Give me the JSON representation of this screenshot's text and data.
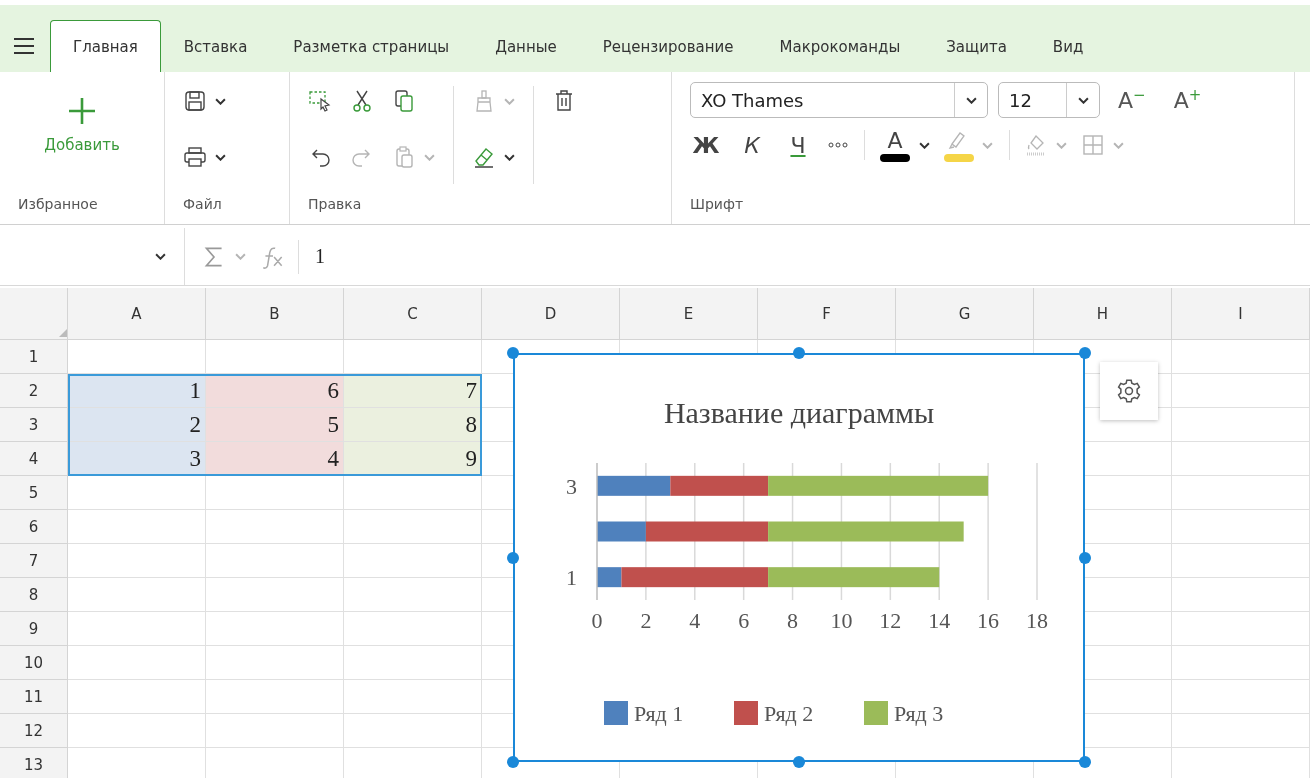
{
  "tabs": [
    {
      "label": "Главная",
      "selected": true
    },
    {
      "label": "Вставка",
      "selected": false
    },
    {
      "label": "Разметка страницы",
      "selected": false
    },
    {
      "label": "Данные",
      "selected": false
    },
    {
      "label": "Рецензирование",
      "selected": false
    },
    {
      "label": "Макрокоманды",
      "selected": false
    },
    {
      "label": "Защита",
      "selected": false
    },
    {
      "label": "Вид",
      "selected": false
    }
  ],
  "ribbon": {
    "favorites": {
      "label": "Избранное",
      "add_button": "Добавить"
    },
    "file": {
      "label": "Файл",
      "columns": [
        [
          {
            "kind": "save",
            "caret": true,
            "disabled": false
          },
          {
            "kind": "print",
            "caret": true,
            "disabled": false
          }
        ]
      ]
    },
    "edit": {
      "label": "Правка",
      "columns": [
        {
          "divider_before": false,
          "tools": [
            {
              "kind": "select",
              "caret": false,
              "disabled": false
            },
            {
              "kind": "undo",
              "caret": false,
              "disabled": false
            }
          ]
        },
        {
          "divider_before": false,
          "tools": [
            {
              "kind": "cut",
              "caret": false,
              "disabled": false
            },
            {
              "kind": "redo",
              "caret": false,
              "disabled": true
            }
          ]
        },
        {
          "divider_before": false,
          "tools": [
            {
              "kind": "copy",
              "caret": false,
              "disabled": false
            },
            {
              "kind": "paste",
              "caret": true,
              "disabled": true
            }
          ]
        },
        {
          "divider_before": true,
          "tools": [
            {
              "kind": "brush",
              "caret": true,
              "disabled": true
            },
            {
              "kind": "eraser",
              "caret": true,
              "disabled": false
            }
          ]
        },
        {
          "divider_before": true,
          "tools": [
            {
              "kind": "trash",
              "caret": false,
              "disabled": false
            }
          ]
        }
      ]
    },
    "font": {
      "label": "Шрифт",
      "font_name": "XO Thames",
      "font_size": "12",
      "size_tools": [
        {
          "label": "A$^{−}$"
        },
        {
          "label": "A$^{+}$"
        }
      ],
      "tools": [
        {
          "kind": "bold",
          "label": "Ж",
          "caret": false,
          "disabled": false,
          "divider_before": false
        },
        {
          "kind": "italic",
          "label": "К",
          "caret": false,
          "disabled": false,
          "divider_before": false
        },
        {
          "kind": "underline",
          "label": "Ч",
          "caret": false,
          "disabled": false,
          "divider_before": false
        },
        {
          "kind": "more",
          "caret": false,
          "disabled": false,
          "divider_before": false
        },
        {
          "kind": "font-color",
          "label": "А",
          "color": "#000000",
          "caret": true,
          "disabled": false,
          "divider_before": true
        },
        {
          "kind": "highlight",
          "color": "#f5d547",
          "caret": true,
          "disabled": true,
          "divider_before": false
        },
        {
          "kind": "fill",
          "caret": true,
          "disabled": true,
          "divider_before": true
        },
        {
          "kind": "borders",
          "caret": true,
          "disabled": true,
          "divider_before": false
        }
      ]
    }
  },
  "formula_bar": {
    "value": "1"
  },
  "sheet": {
    "columns": [
      "A",
      "B",
      "C",
      "D",
      "E",
      "F",
      "G",
      "H",
      "I"
    ],
    "rows": [
      {
        "header": "1"
      },
      {
        "header": "2",
        "cells": [
          {
            "value": "1",
            "color": "#dce5f1"
          },
          {
            "value": "6",
            "color": "#f2dcdc"
          },
          {
            "value": "7",
            "color": "#ebf0df"
          }
        ]
      },
      {
        "header": "3",
        "cells": [
          {
            "value": "2",
            "color": "#dce5f1"
          },
          {
            "value": "5",
            "color": "#f2dcdc"
          },
          {
            "value": "8",
            "color": "#ebf0df"
          }
        ]
      },
      {
        "header": "4",
        "cells": [
          {
            "value": "3",
            "color": "#dce5f1"
          },
          {
            "value": "4",
            "color": "#f2dcdc"
          },
          {
            "value": "9",
            "color": "#ebf0df"
          }
        ]
      },
      {
        "header": "5"
      },
      {
        "header": "6"
      },
      {
        "header": "7"
      },
      {
        "header": "8"
      },
      {
        "header": "9"
      },
      {
        "header": "10"
      },
      {
        "header": "11"
      },
      {
        "header": "12"
      },
      {
        "header": "13"
      }
    ],
    "chart": {
      "chart_data": {
        "type": "bar",
        "orientation": "horizontal",
        "stacked": true,
        "title": "Название диаграммы",
        "categories": [
          "3",
          null,
          "1"
        ],
        "series": [
          {
            "name": "Ряд 1",
            "color": "#4f81bd",
            "values": [
              3,
              2,
              1
            ]
          },
          {
            "name": "Ряд 2",
            "color": "#c0504d",
            "values": [
              4,
              5,
              6
            ]
          },
          {
            "name": "Ряд 3",
            "color": "#9bbb59",
            "values": [
              9,
              8,
              7
            ]
          }
        ],
        "grid": true,
        "legend": "bottom",
        "xlim": [
          0,
          18
        ],
        "xticks": [
          0,
          2,
          4,
          6,
          8,
          10,
          12,
          14,
          16,
          18
        ]
      }
    }
  }
}
